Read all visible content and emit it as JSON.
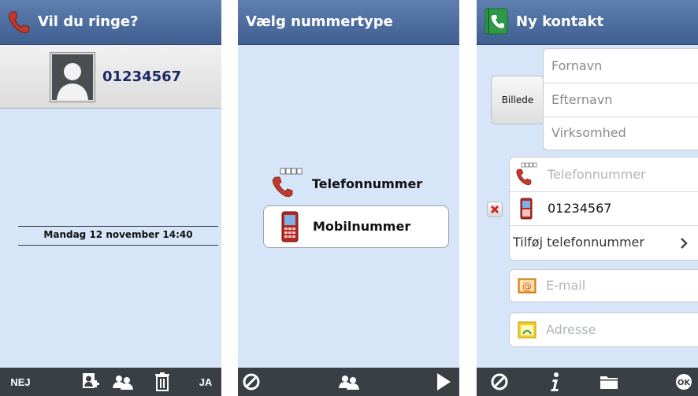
{
  "screen1": {
    "title": "Vil du ringe?",
    "contact_number": "01234567",
    "datetime": "Mandag 12 november 14:40",
    "bottom": {
      "no_label": "NEJ",
      "yes_label": "JA"
    }
  },
  "screen2": {
    "title": "Vælg nummertype",
    "options": [
      {
        "label": "Telefonnummer",
        "icon": "landline-phone-icon"
      },
      {
        "label": "Mobilnummer",
        "icon": "mobile-phone-icon"
      }
    ]
  },
  "screen3": {
    "title": "Ny kontakt",
    "photo_button": "Billede",
    "name_fields": [
      {
        "placeholder": "Fornavn"
      },
      {
        "placeholder": "Efternavn"
      },
      {
        "placeholder": "Virksomhed"
      }
    ],
    "phone_placeholder": "Telefonnummer",
    "mobile_value": "01234567",
    "add_phone_label": "Tilføj telefonnummer",
    "email_placeholder": "E-mail",
    "address_placeholder": "Adresse"
  },
  "colors": {
    "title_bar": "#4a6da3",
    "content_bg": "#d6e5f7",
    "bottom_bar": "#3a3f46",
    "number_text": "#1a2a66",
    "phone_red": "#c0392b"
  }
}
